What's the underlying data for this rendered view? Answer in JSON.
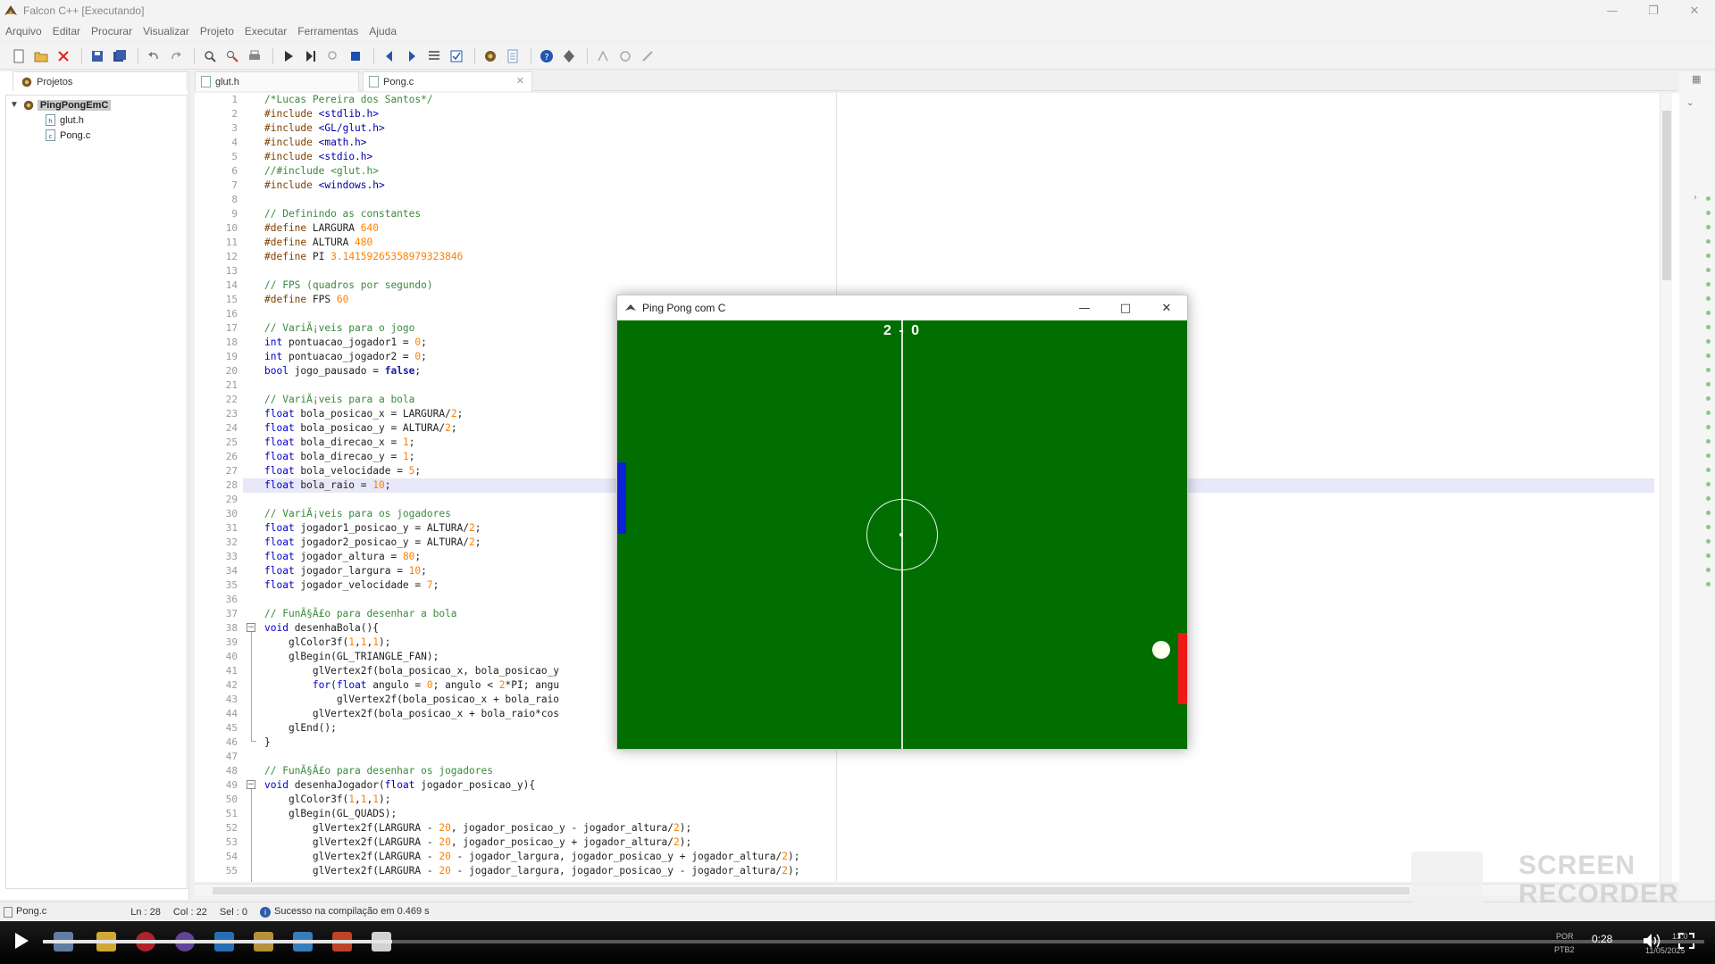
{
  "window": {
    "title": "Falcon C++ [Executando]"
  },
  "menu": [
    "Arquivo",
    "Editar",
    "Procurar",
    "Visualizar",
    "Projeto",
    "Executar",
    "Ferramentas",
    "Ajuda"
  ],
  "projects_panel": {
    "tab_label": "Projetos",
    "root": "PingPongEmC",
    "files": [
      "glut.h",
      "Pong.c"
    ]
  },
  "editor_tabs": [
    {
      "label": "glut.h"
    },
    {
      "label": "Pong.c"
    }
  ],
  "code_lines": [
    "/*Lucas Pereira dos Santos*/",
    "#include <stdlib.h>",
    "#include <GL/glut.h>",
    "#include <math.h>",
    "#include <stdio.h>",
    "//#include <glut.h>",
    "#include <windows.h>",
    "",
    "// Definindo as constantes",
    "#define LARGURA 640",
    "#define ALTURA 480",
    "#define PI 3.14159265358979323846",
    "",
    "// FPS (quadros por segundo)",
    "#define FPS 60",
    "",
    "// VariÃ¡veis para o jogo",
    "int pontuacao_jogador1 = 0;",
    "int pontuacao_jogador2 = 0;",
    "bool jogo_pausado = false;",
    "",
    "// VariÃ¡veis para a bola",
    "float bola_posicao_x = LARGURA/2;",
    "float bola_posicao_y = ALTURA/2;",
    "float bola_direcao_x = 1;",
    "float bola_direcao_y = 1;",
    "float bola_velocidade = 5;",
    "float bola_raio = 10;",
    "",
    "// VariÃ¡veis para os jogadores",
    "float jogador1_posicao_y = ALTURA/2;",
    "float jogador2_posicao_y = ALTURA/2;",
    "float jogador_altura = 80;",
    "float jogador_largura = 10;",
    "float jogador_velocidade = 7;",
    "",
    "// FunÃ§Ã£o para desenhar a bola",
    "void desenhaBola(){",
    "    glColor3f(1,1,1);",
    "    glBegin(GL_TRIANGLE_FAN);",
    "        glVertex2f(bola_posicao_x, bola_posicao_y",
    "        for(float angulo = 0; angulo < 2*PI; angu",
    "            glVertex2f(bola_posicao_x + bola_raio",
    "        glVertex2f(bola_posicao_x + bola_raio*cos",
    "    glEnd();",
    "}",
    "",
    "// FunÃ§Ã£o para desenhar os jogadores",
    "void desenhaJogador(float jogador_posicao_y){",
    "    glColor3f(1,1,1);",
    "    glBegin(GL_QUADS);",
    "        glVertex2f(LARGURA - 20, jogador_posicao_y - jogador_altura/2);",
    "        glVertex2f(LARGURA - 20, jogador_posicao_y + jogador_altura/2);",
    "        glVertex2f(LARGURA - 20 - jogador_largura, jogador_posicao_y + jogador_altura/2);",
    "        glVertex2f(LARGURA - 20 - jogador_largura, jogador_posicao_y - jogador_altura/2);"
  ],
  "statusbar": {
    "file": "Pong.c",
    "line": "Ln : 28",
    "col": "Col : 22",
    "sel": "Sel : 0",
    "message": "Sucesso na compilação em 0.469 s"
  },
  "game_window": {
    "title": "Ping Pong com C",
    "score_left": "2",
    "score_right": "0",
    "colors": {
      "field": "#006e00",
      "paddle_left": "#0b22d8",
      "paddle_right": "#ee1a1a",
      "ball": "#fffff0"
    }
  },
  "player": {
    "time": "0:28",
    "progress_fraction": 0.21,
    "tray": {
      "lang": "POR",
      "layout": "PTB2",
      "clock": "13:0",
      "date": "11/05/2025"
    }
  },
  "watermark": {
    "line1": "SCREEN",
    "line2": "RECORDER"
  },
  "icons": {
    "new": "new-file-icon",
    "open": "open-folder-icon",
    "close": "close-file-icon",
    "save": "save-icon",
    "save_all": "save-all-icon",
    "undo": "undo-icon",
    "redo": "redo-icon",
    "find": "find-icon",
    "replace": "replace-icon",
    "print": "print-icon",
    "run": "run-icon",
    "step": "step-icon",
    "stop": "stop-icon",
    "build": "build-icon",
    "help": "help-icon"
  }
}
